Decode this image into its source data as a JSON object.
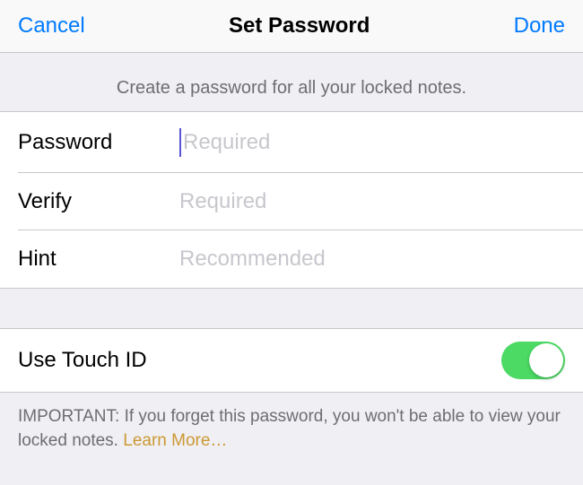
{
  "nav": {
    "cancel": "Cancel",
    "title": "Set Password",
    "done": "Done"
  },
  "header": {
    "subtitle": "Create a password for all your locked notes."
  },
  "fields": {
    "password": {
      "label": "Password",
      "placeholder": "Required"
    },
    "verify": {
      "label": "Verify",
      "placeholder": "Required"
    },
    "hint": {
      "label": "Hint",
      "placeholder": "Recommended"
    }
  },
  "touchid": {
    "label": "Use Touch ID",
    "enabled": true
  },
  "footer": {
    "important": "IMPORTANT: If you forget this password, you won't be able to view your locked notes. ",
    "learn_more": "Learn More…"
  }
}
